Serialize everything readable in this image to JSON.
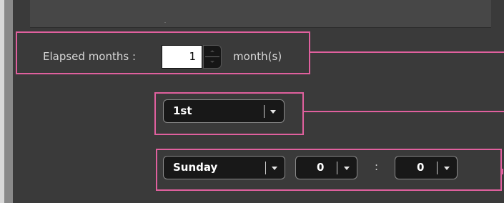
{
  "elapsed": {
    "label": "Elapsed months :",
    "value": "1",
    "unit": "month(s)"
  },
  "ordinal_select": {
    "value": "1st"
  },
  "day_select": {
    "value": "Sunday"
  },
  "hour_select": {
    "value": "0"
  },
  "time_separator": ":",
  "minute_select": {
    "value": "0"
  },
  "colors": {
    "highlight": "#e0609e",
    "panel_bg": "#3a3a3a",
    "control_bg": "#181818",
    "text": "#d8d8d8"
  },
  "icons": {
    "dropdown": "chevron-down-icon",
    "spinner_up": "arrow-up-icon",
    "spinner_down": "arrow-down-icon"
  }
}
